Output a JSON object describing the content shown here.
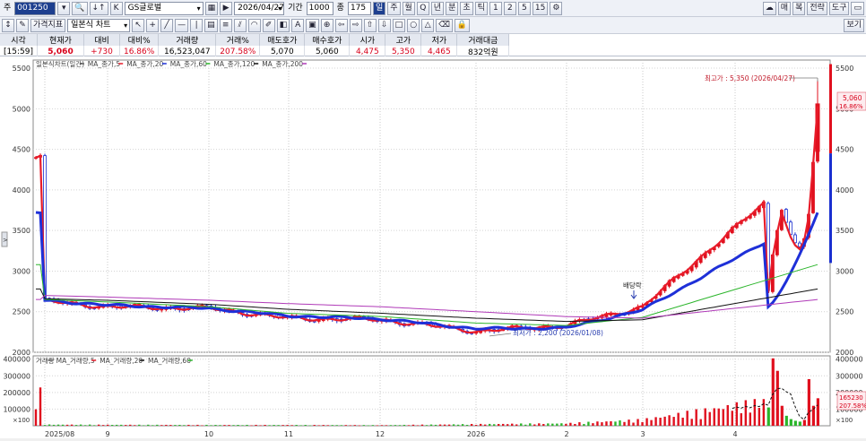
{
  "toolbar": {
    "code_prefix": "주",
    "stock_code": "001250",
    "name": "GS글로벌",
    "date": "2026/04/27",
    "period_label": "기간",
    "period_value": "1000",
    "count_label": "종",
    "count_value": "175",
    "periods": [
      "일",
      "주",
      "월",
      "Q",
      "년",
      "분",
      "초",
      "틱",
      "1",
      "2",
      "5",
      "15"
    ],
    "right_buttons": [
      "매",
      "복",
      "전략",
      "도구"
    ],
    "indicator_button": "가격지표",
    "chart_type": "일본식 차트",
    "view_button": "보기"
  },
  "quote": {
    "headers": [
      "시각",
      "현재가",
      "대비",
      "대비%",
      "거래량",
      "거래%",
      "매도호가",
      "매수호가",
      "시가",
      "고가",
      "저가",
      "거래대금"
    ],
    "values": [
      "[15:59]",
      "5,060",
      "+730",
      "16.86%",
      "16,523,047",
      "207.58%",
      "5,070",
      "5,060",
      "4,475",
      "5,350",
      "4,465",
      "832억원"
    ]
  },
  "price_panel": {
    "legend": [
      "일본식차트(일간)",
      "MA_종가,5",
      "MA_종가,20",
      "MA_종가,60",
      "MA_종가,120",
      "MA_종가,200"
    ],
    "y_ticks": [
      "5500",
      "5000",
      "4500",
      "4000",
      "3500",
      "3000",
      "2500",
      "2000"
    ],
    "annotation_high": "최고가 : 5,350 (2026/04/27)",
    "annotation_low": "최저가 : 2,200 (2026/01/08)",
    "annotation_dividend": "배당락",
    "current_price": "5,060",
    "current_change": "16.86%"
  },
  "volume_panel": {
    "legend": [
      "거래량",
      "MA_거래량,5",
      "MA_거래량,20",
      "MA_거래량,60"
    ],
    "y_ticks": [
      "400000",
      "300000",
      "200000",
      "100000"
    ],
    "y_unit": "×100",
    "current_volume": "165230",
    "current_pct": "207.58%"
  },
  "x_axis": [
    "2025/08",
    "9",
    "10",
    "11",
    "12",
    "2026",
    "2",
    "3",
    "4"
  ],
  "colors": {
    "up": "#e0101e",
    "down": "#1a2fd0",
    "ma5": "#e81c2a",
    "ma20": "#1e30d8",
    "ma60": "#2bb52b",
    "ma120": "#111111",
    "ma200": "#b03ab8"
  },
  "chart_data": {
    "type": "line",
    "title": "일본식차트(일간)",
    "ylim": [
      2000,
      5600
    ],
    "x": [
      "2025/08",
      "9",
      "10",
      "11",
      "12",
      "2026",
      "2",
      "3",
      "4"
    ],
    "series": [
      {
        "name": "MA_종가,5",
        "values": [
          2630,
          2560,
          2540,
          2420,
          2400,
          2260,
          2330,
          2560,
          4400
        ]
      },
      {
        "name": "MA_종가,20",
        "values": [
          2640,
          2580,
          2540,
          2450,
          2410,
          2290,
          2300,
          2520,
          3720
        ]
      },
      {
        "name": "MA_종가,60",
        "values": [
          2650,
          2620,
          2560,
          2480,
          2440,
          2360,
          2330,
          2430,
          3080
        ]
      },
      {
        "name": "MA_종가,120",
        "values": [
          2660,
          2640,
          2590,
          2530,
          2480,
          2420,
          2380,
          2400,
          2780
        ]
      },
      {
        "name": "MA_종가,200",
        "values": [
          2700,
          2680,
          2640,
          2600,
          2560,
          2500,
          2440,
          2420,
          2650
        ]
      }
    ],
    "volume": {
      "ylim": [
        0,
        420000
      ],
      "labels": [
        "2025/08",
        "9",
        "10",
        "11",
        "12",
        "2026",
        "2",
        "3",
        "4"
      ],
      "values": [
        6000,
        5000,
        4000,
        4000,
        3000,
        8000,
        12000,
        30000,
        165230
      ]
    }
  }
}
